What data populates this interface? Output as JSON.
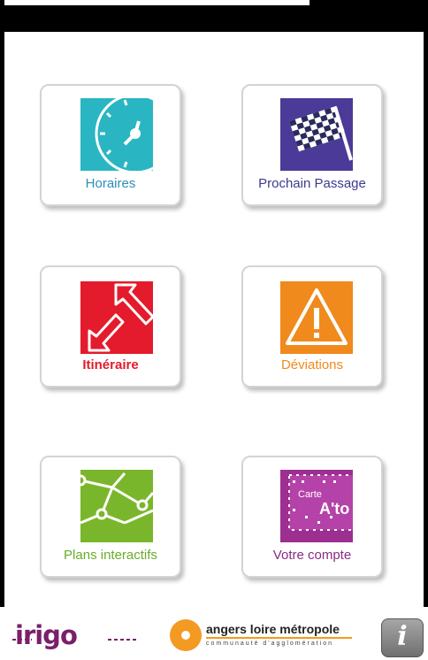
{
  "tiles": [
    {
      "label": "Horaires",
      "icon": "clock-icon",
      "color": "#29b6c2",
      "label_color": "#2a8fb8"
    },
    {
      "label": "Prochain Passage",
      "icon": "checkered-flag-icon",
      "color": "#4b3a97",
      "label_color": "#3b3a8f"
    },
    {
      "label": "Itinéraire",
      "icon": "route-arrows-icon",
      "color": "#e31b2c",
      "label_color": "#e31b2c"
    },
    {
      "label": "Déviations",
      "icon": "warning-icon",
      "color": "#f08a1c",
      "label_color": "#f08a1c"
    },
    {
      "label": "Plans interactifs",
      "icon": "network-map-icon",
      "color": "#7ab62b",
      "label_color": "#6aac2a"
    },
    {
      "label": "Votre compte",
      "icon": "transit-card-icon",
      "color": "#9c2f8f",
      "label_color": "#8b2a84"
    }
  ],
  "card_text": {
    "line1": "Carte",
    "line2": "A'to"
  },
  "footer": {
    "irigo": "irigo",
    "metro_title": "angers loire métropole",
    "metro_sub": "communauté d'agglomération",
    "info": "i"
  },
  "colors": {
    "irigo": "#7a1f6a",
    "metro": "#f39a22"
  }
}
